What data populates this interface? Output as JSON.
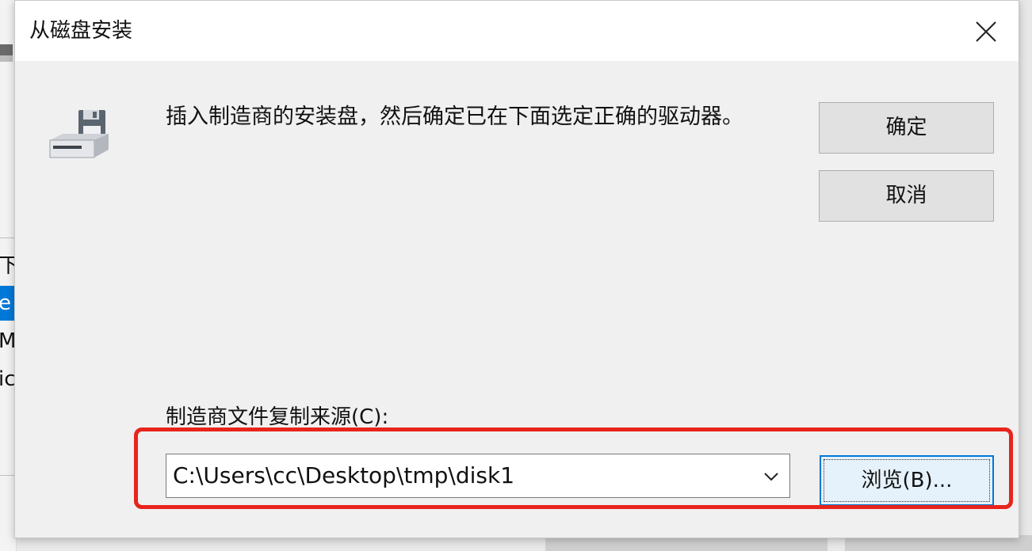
{
  "dialog": {
    "title": "从磁盘安装",
    "message": "插入制造商的安装盘，然后确定已在下面选定正确的驱动器。",
    "ok_label": "确定",
    "cancel_label": "取消",
    "source_label": "制造商文件复制来源(C):",
    "source_value": "C:\\Users\\cc\\Desktop\\tmp\\disk1",
    "browse_label": "浏览(B)...",
    "icons": {
      "close": "close-icon",
      "disk": "floppy-drive-icon",
      "dropdown": "chevron-down-icon"
    }
  },
  "background": {
    "fragments": [
      "下",
      "e",
      "Mi",
      "ic"
    ]
  },
  "colors": {
    "highlight": "#e8241c",
    "focus": "#0078d7",
    "selected_row": "#0078d7"
  }
}
